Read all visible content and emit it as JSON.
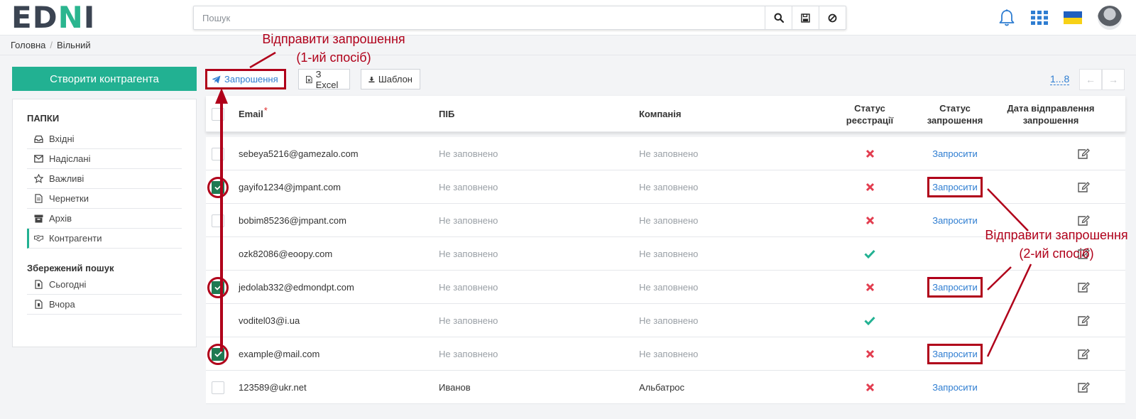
{
  "logo": {
    "part1": "ED",
    "part2": "N",
    "part3": "I"
  },
  "search": {
    "placeholder": "Пошук",
    "value": ""
  },
  "breadcrumb": {
    "home": "Головна",
    "current": "Вільний"
  },
  "sidebar": {
    "create_label": "Створити контрагента",
    "folders_title": "ПАПКИ",
    "folders": [
      {
        "label": "Вхідні",
        "icon": "inbox-icon"
      },
      {
        "label": "Надіслані",
        "icon": "envelope-icon"
      },
      {
        "label": "Важливі",
        "icon": "star-icon"
      },
      {
        "label": "Чернетки",
        "icon": "draft-icon"
      },
      {
        "label": "Архів",
        "icon": "archive-icon"
      },
      {
        "label": "Контрагенти",
        "icon": "handshake-icon",
        "active": true
      }
    ],
    "saved_title": "Збережений пошук",
    "saved": [
      {
        "label": "Сьогодні",
        "icon": "saved-doc-icon"
      },
      {
        "label": "Вчора",
        "icon": "saved-doc-icon"
      }
    ]
  },
  "toolbar": {
    "invite_label": "Запрошення",
    "excel_label": "З Excel",
    "template_label": "Шаблон"
  },
  "pager": {
    "label": "1...8"
  },
  "table": {
    "headers": {
      "email": "Email",
      "email_required": "*",
      "name": "ПІБ",
      "company": "Компанія",
      "reg_status_1": "Статус",
      "reg_status_2": "реєстрації",
      "inv_status_1": "Статус",
      "inv_status_2": "запрошення",
      "sent_date_1": "Дата відправлення",
      "sent_date_2": "запрошення"
    },
    "rows": [
      {
        "email": "sebeya5216@gamezalo.com",
        "name": "Не заповнено",
        "company": "Не заповнено",
        "registered": false,
        "invite": "Запросити",
        "checkbox": "unchecked",
        "highlight": false
      },
      {
        "email": "gayifo1234@jmpant.com",
        "name": "Не заповнено",
        "company": "Не заповнено",
        "registered": false,
        "invite": "Запросити",
        "checkbox": "checked",
        "highlight": true
      },
      {
        "email": "bobim85236@jmpant.com",
        "name": "Не заповнено",
        "company": "Не заповнено",
        "registered": false,
        "invite": "Запросити",
        "checkbox": "unchecked",
        "highlight": false
      },
      {
        "email": "ozk82086@eoopy.com",
        "name": "Не заповнено",
        "company": "Не заповнено",
        "registered": true,
        "invite": "",
        "checkbox": "none",
        "highlight": false
      },
      {
        "email": "jedolab332@edmondpt.com",
        "name": "Не заповнено",
        "company": "Не заповнено",
        "registered": false,
        "invite": "Запросити",
        "checkbox": "checked",
        "highlight": true
      },
      {
        "email": "voditel03@i.ua",
        "name": "Не заповнено",
        "company": "Не заповнено",
        "registered": true,
        "invite": "",
        "checkbox": "none",
        "highlight": false
      },
      {
        "email": "example@mail.com",
        "name": "Не заповнено",
        "company": "Не заповнено",
        "registered": false,
        "invite": "Запросити",
        "checkbox": "checked",
        "highlight": true
      },
      {
        "email": "123589@ukr.net",
        "name": "Иванов",
        "company": "Альбатрос",
        "registered": false,
        "invite": "Запросити",
        "checkbox": "unchecked",
        "highlight": false
      }
    ]
  },
  "annotations": {
    "first_line1": "Відправити запрошення",
    "first_line2": "(1-ий спосіб)",
    "second_line1": "Відправити запрошення",
    "second_line2": "(2-ий спосіб)"
  },
  "colors": {
    "accent": "#22b192",
    "link": "#2e7dd1",
    "annotation": "#b0001a",
    "error": "#e23d4f"
  }
}
